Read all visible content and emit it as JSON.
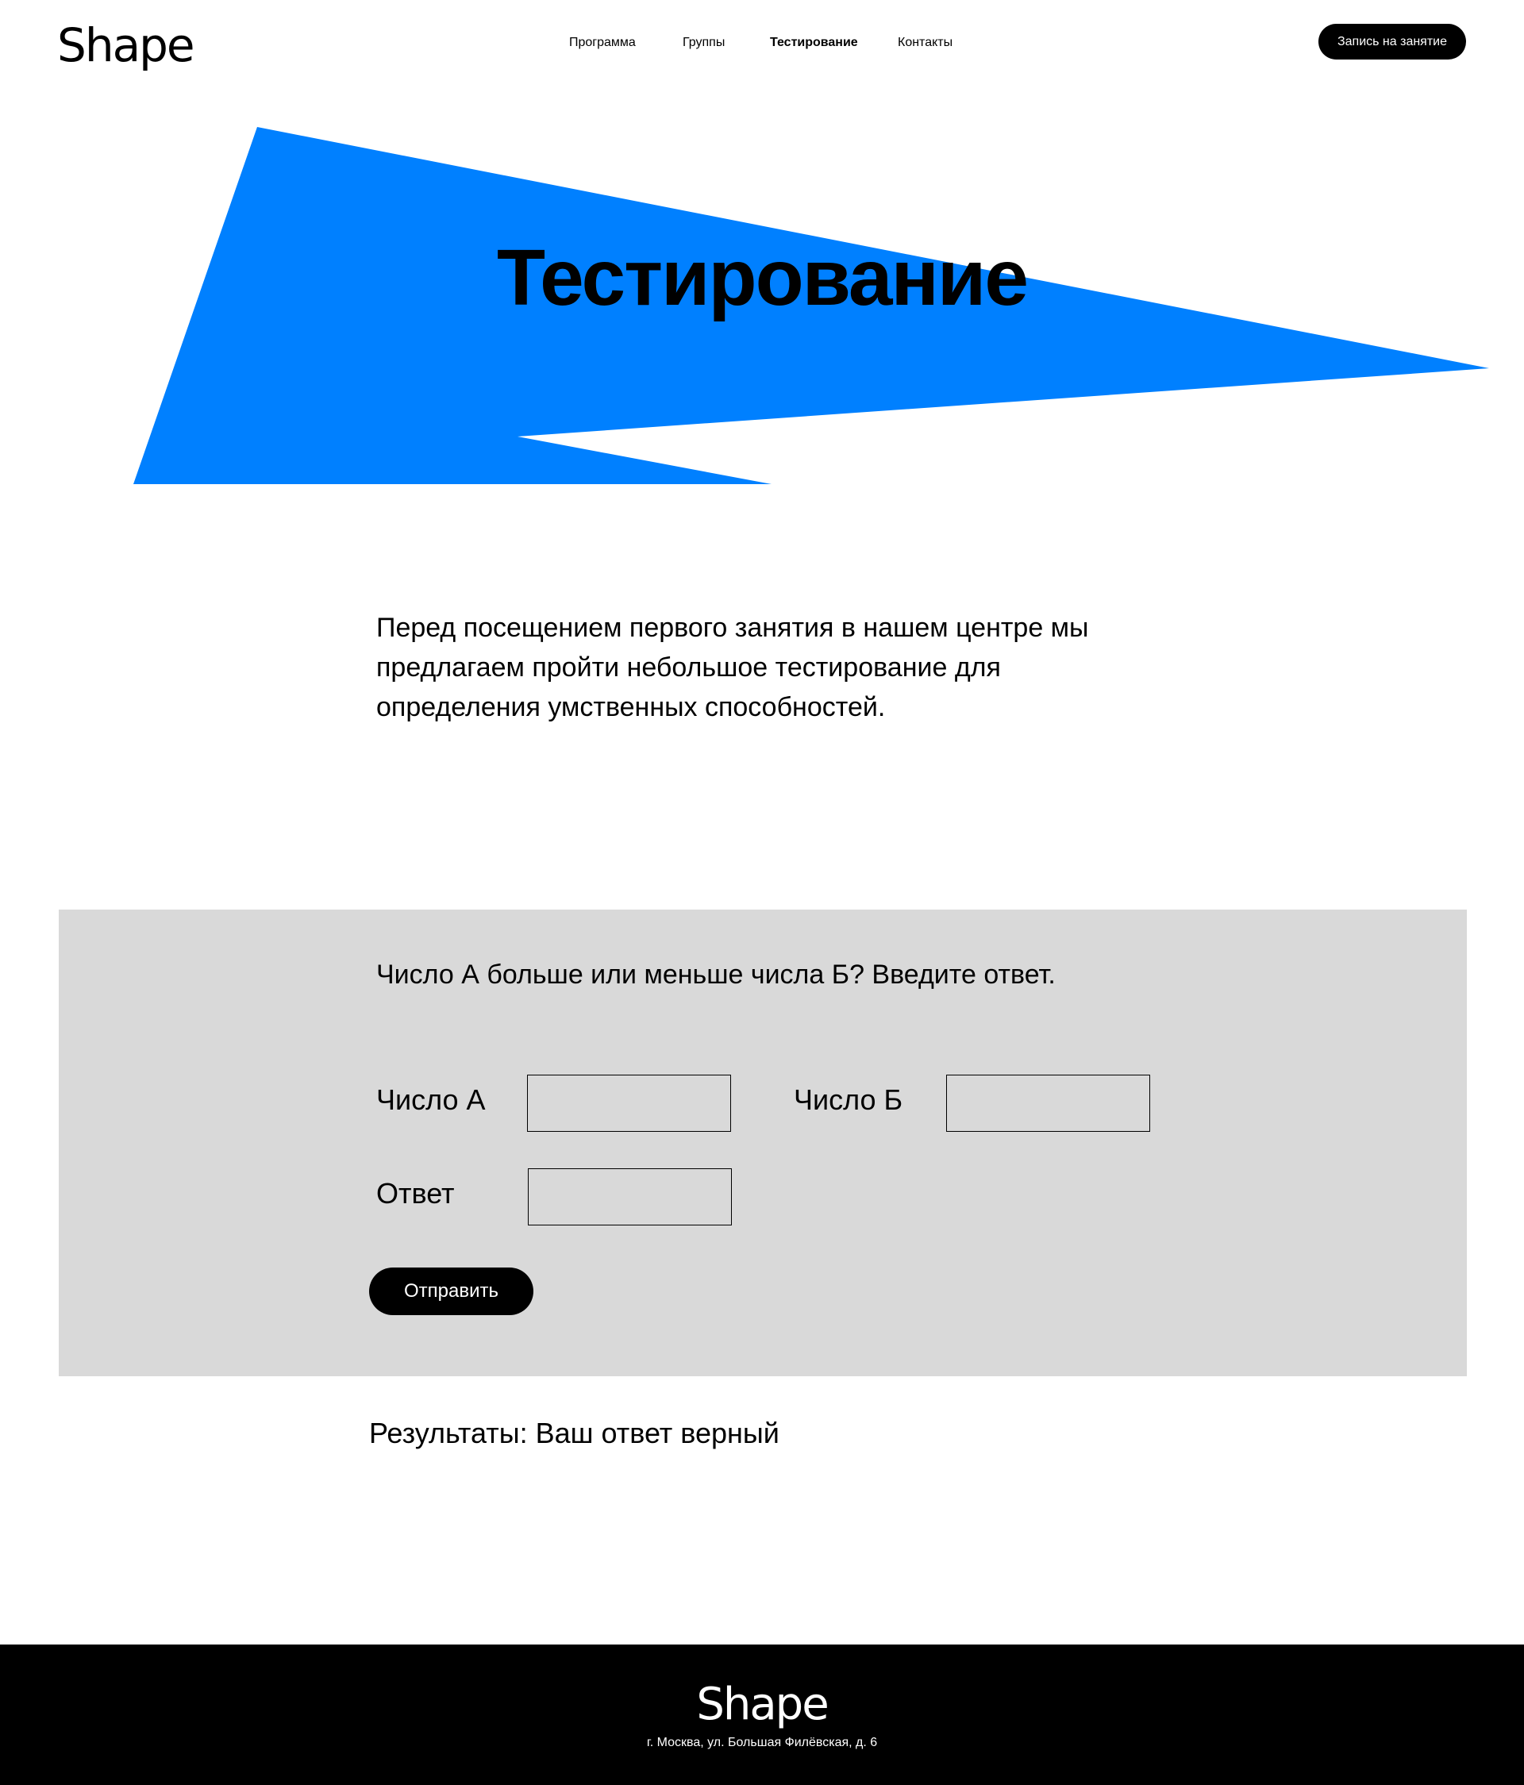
{
  "colors": {
    "accent": "#0080ff",
    "panel": "#d9d9d9",
    "dark": "#000000",
    "background": "#ffffff"
  },
  "header": {
    "logo": "Shape",
    "nav": [
      {
        "label": "Программа"
      },
      {
        "label": "Группы"
      },
      {
        "label": "Тестирование",
        "active": true
      },
      {
        "label": "Контакты"
      }
    ],
    "cta_label": "Запись на занятие"
  },
  "hero": {
    "title": "Тестирование"
  },
  "intro": {
    "text": "Перед посещением первого занятия в нашем центре мы предлагаем пройти небольшое тестирование для определения умственных способностей."
  },
  "test": {
    "question": "Число А больше или меньше числа Б? Введите ответ.",
    "field_a_label": "Число А",
    "field_a_value": "",
    "field_b_label": "Число Б",
    "field_b_value": "",
    "answer_label": "Ответ",
    "answer_value": "",
    "submit_label": "Отправить"
  },
  "results": {
    "text": "Результаты: Ваш ответ верный"
  },
  "footer": {
    "logo": "Shape",
    "address": "г. Москва, ул. Большая Филёвская, д. 6"
  }
}
